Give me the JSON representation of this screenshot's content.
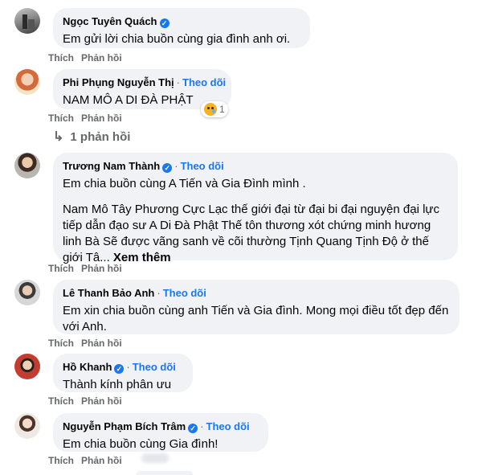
{
  "labels": {
    "like": "Thích",
    "reply": "Phản hồi",
    "follow": "Theo dõi",
    "see_more": "Xem thêm",
    "verified_mark": "✓"
  },
  "colors": {
    "accent": "#1877f2",
    "bubble": "#f0f2f5",
    "muted": "#65676b"
  },
  "comments": [
    {
      "name": "Ngọc Tuyên Quách",
      "verified": true,
      "follow": false,
      "text": [
        "Em gửi lời chia buồn cùng gia đình anh ơi."
      ]
    },
    {
      "name": "Phi Phụng Nguyễn Thị",
      "verified": false,
      "follow": true,
      "text": [
        "NAM MÔ A DI ĐÀ PHẬT"
      ],
      "reaction": {
        "icon": "sad-cry-icon",
        "count": "1"
      },
      "replies": "1 phản hồi"
    },
    {
      "name": "Trương Nam Thành",
      "verified": true,
      "follow": true,
      "text": [
        "Em chia buồn cùng A Tiến và Gia Đình mình .",
        "Nam Mô Tây Phương Cực Lạc thế giới đại từ đại bi đại nguyện đại lực tiếp dẫn đạo sư A Di Đà Phật Thế tôn thương xót chứng minh hương linh Bà Sẽ được vãng sanh về cõi thường Tịnh Quang Tịnh Độ ở thế giới Tâ..."
      ]
    },
    {
      "name": "Lê Thanh Bảo Anh",
      "verified": false,
      "follow": true,
      "text": [
        "Em xin chia buồn cùng anh Tiến và Gia đình. Mong mọi điều tốt đẹp đến với Anh."
      ]
    },
    {
      "name": "Hồ Khanh",
      "verified": true,
      "follow": true,
      "text": [
        "Thành kính phân ưu"
      ]
    },
    {
      "name": "Nguyễn Phạm Bích Trâm",
      "verified": true,
      "follow": true,
      "text": [
        "Em chia buồn cùng Gia đình!"
      ]
    }
  ]
}
